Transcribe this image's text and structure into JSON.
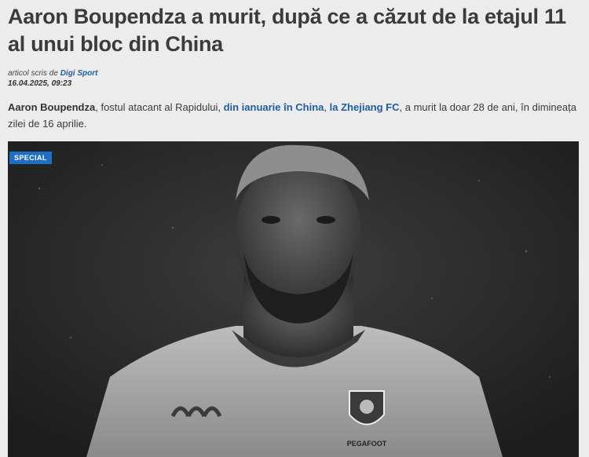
{
  "article": {
    "title": "Aaron Boupendza a murit, după ce a căzut de la etajul 11 al unui bloc din China",
    "byline_prefix": "articol scris de ",
    "author": "Digi Sport",
    "date": "16.04.2025, 09:23",
    "lead": {
      "name": "Aaron Boupendza",
      "part1": ", fostul atacant al Rapidului, ",
      "link1": "din ianuarie în China",
      "sep": ", ",
      "link2": "la Zhejiang FC",
      "part2": ", a murit la doar 28 de ani, în dimineața zilei de 16 aprilie."
    },
    "badge": "SPECIAL",
    "photo": {
      "jersey_text": "PEGAFOOT",
      "brand_icon": "kappa-logo-icon",
      "crest_icon": "club-crest-icon",
      "tone": "grayscale"
    }
  },
  "colors": {
    "link": "#1f5e9e",
    "badge_bg": "#1d6fc4",
    "page_bg": "#ececec"
  }
}
